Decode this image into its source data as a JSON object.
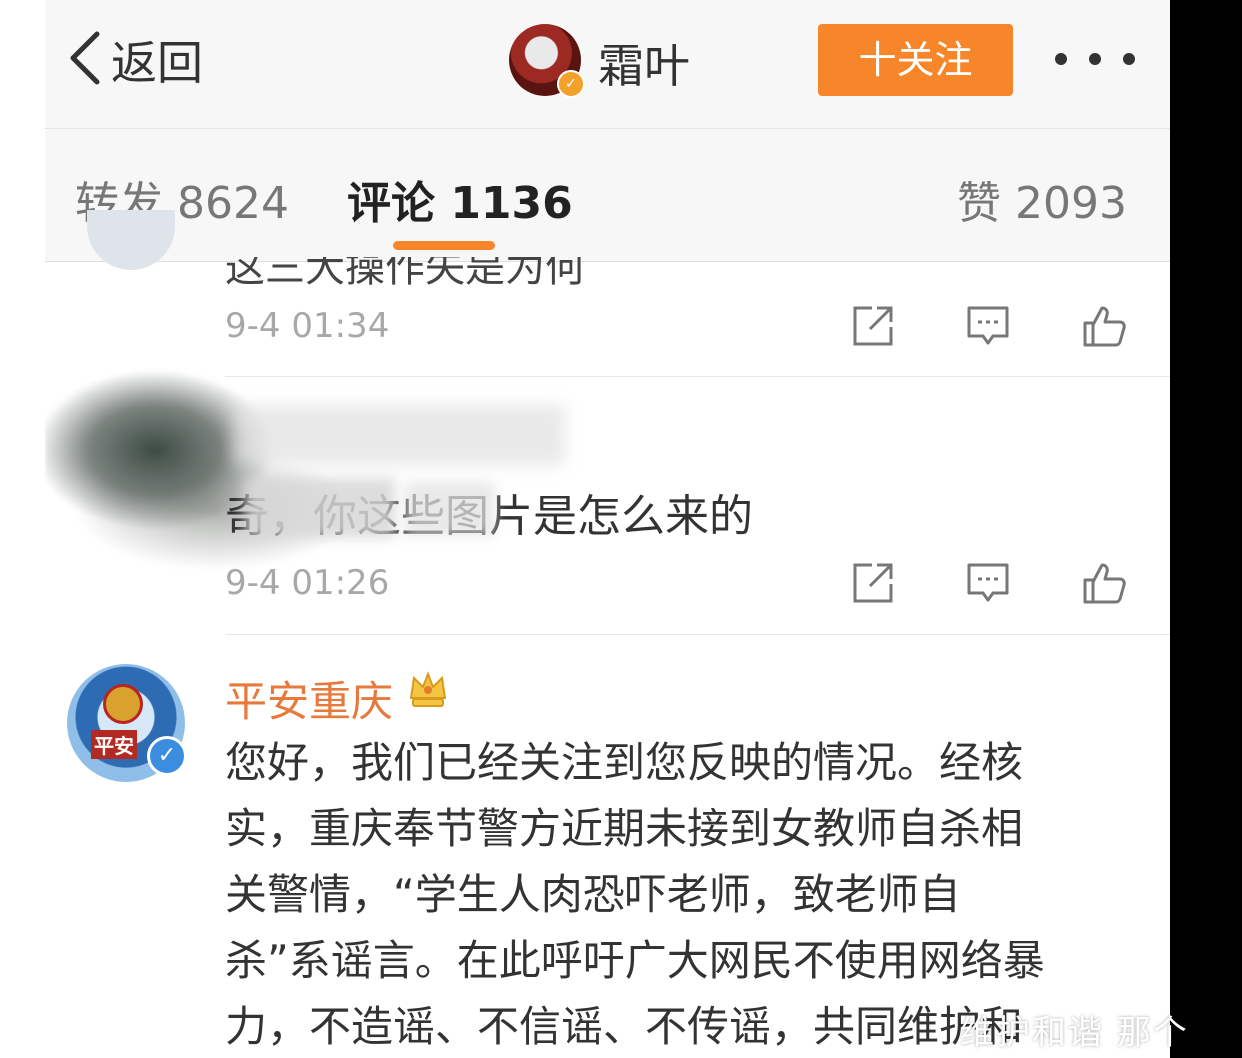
{
  "header": {
    "back_label": "返回",
    "username": "霜叶",
    "follow_label": "十关注"
  },
  "tabs": [
    {
      "label": "转发 8624"
    },
    {
      "label": "评论 1136"
    },
    {
      "label": "赞 2093"
    }
  ],
  "comments": [
    {
      "partial_text": "这三大操作失是为何",
      "time": "9-4 01:34"
    },
    {
      "text": "奇，你这些图片是怎么来的",
      "time": "9-4 01:26"
    },
    {
      "name": "平安重庆",
      "avatar_text": "平安",
      "lines": [
        "您好，我们已经关注到您反映的情况。经核",
        "实，重庆奉节警方近期未接到女教师自杀相",
        "关警情，“学生人肉恐吓老师，致老师自",
        "杀”系谣言。在此呼吁广大网民不使用网络暴",
        "力，不造谣、不信谣、不传谣，共同维护和"
      ]
    }
  ],
  "watermark": "维护和谐 那个",
  "colors": {
    "accent": "#f7862b",
    "name_orange": "#e8793d",
    "verified_blue": "#3b8de0"
  }
}
